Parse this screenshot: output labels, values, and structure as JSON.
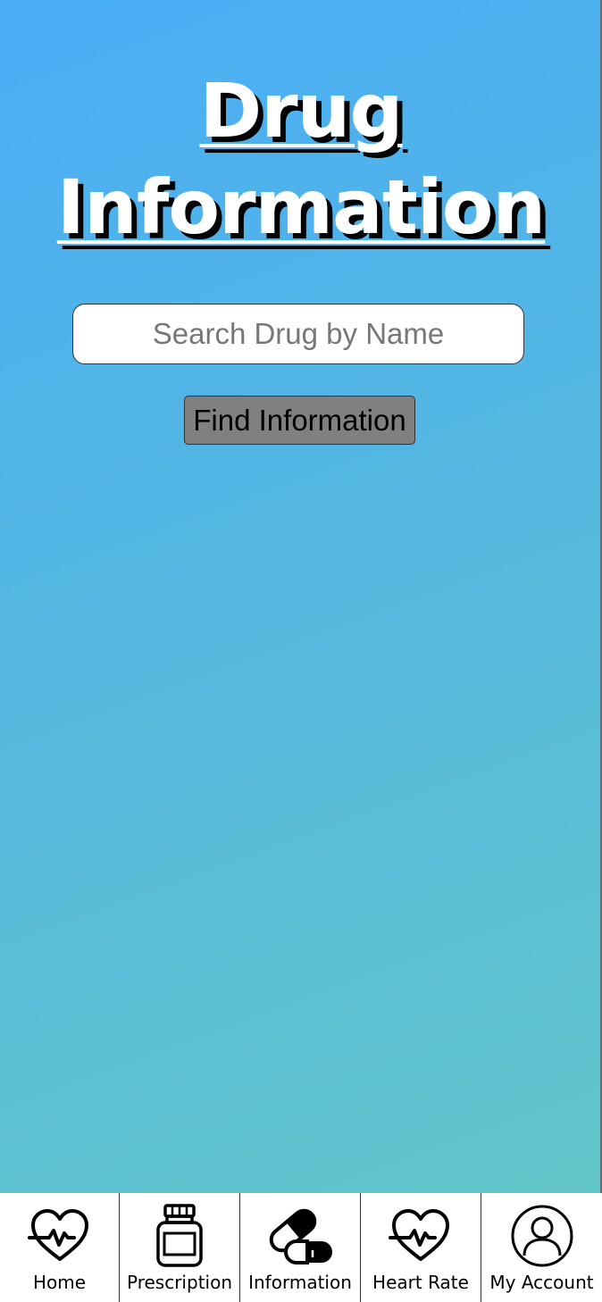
{
  "page": {
    "title_line1": "Drug",
    "title_line2": "Information"
  },
  "search": {
    "placeholder": "Search Drug by Name",
    "value": "",
    "button_label": "Find Information"
  },
  "nav": {
    "items": [
      {
        "label": "Home",
        "icon": "heartbeat-icon"
      },
      {
        "label": "Prescription",
        "icon": "pill-bottle-icon"
      },
      {
        "label": "Information",
        "icon": "capsule-icon"
      },
      {
        "label": "Heart Rate",
        "icon": "heartbeat-icon"
      },
      {
        "label": "My Account",
        "icon": "user-account-icon"
      }
    ]
  },
  "colors": {
    "background_start": "#4aadf6",
    "background_end": "#64c9c6",
    "button_bg": "#808080",
    "title_text": "#ffffff",
    "title_shadow": "#000000"
  }
}
